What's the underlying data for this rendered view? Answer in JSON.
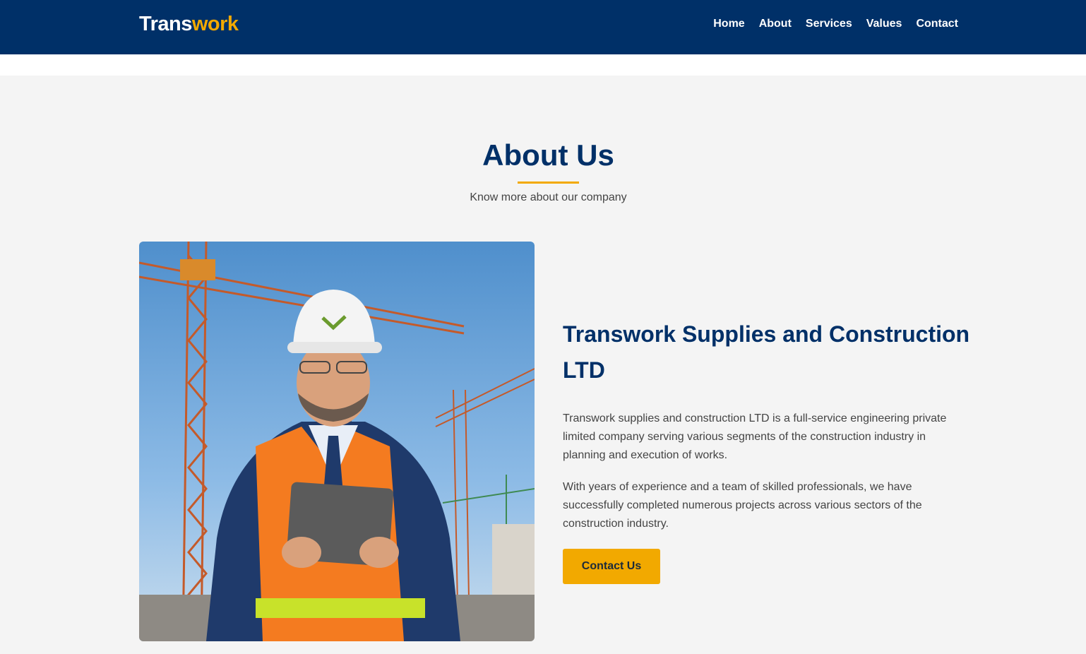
{
  "brand": {
    "part1": "Trans",
    "part2": "work"
  },
  "nav": [
    {
      "label": "Home"
    },
    {
      "label": "About"
    },
    {
      "label": "Services"
    },
    {
      "label": "Values"
    },
    {
      "label": "Contact"
    }
  ],
  "about": {
    "title": "About Us",
    "subtitle": "Know more about our company",
    "heading": "Transwork Supplies and Construction LTD",
    "paragraphs": [
      "Transwork supplies and construction LTD is a full-service engineering private limited company serving various segments of the construction industry in planning and execution of works.",
      "With years of experience and a team of skilled professionals, we have successfully completed numerous projects across various sectors of the construction industry."
    ],
    "button_label": "Contact Us"
  },
  "colors": {
    "navy": "#003068",
    "accent": "#f2a900",
    "background": "#f4f4f4"
  }
}
